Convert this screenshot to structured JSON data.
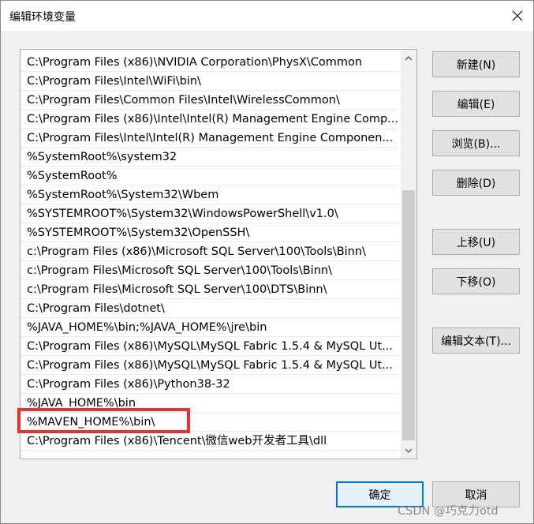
{
  "window": {
    "title": "编辑环境变量"
  },
  "path_list": {
    "items": [
      "C:\\Program Files (x86)\\NVIDIA Corporation\\PhysX\\Common",
      "C:\\Program Files\\Intel\\WiFi\\bin\\",
      "C:\\Program Files\\Common Files\\Intel\\WirelessCommon\\",
      "C:\\Program Files (x86)\\Intel\\Intel(R) Management Engine Comp...",
      "C:\\Program Files\\Intel\\Intel(R) Management Engine Componen...",
      "%SystemRoot%\\system32",
      "%SystemRoot%",
      "%SystemRoot%\\System32\\Wbem",
      "%SYSTEMROOT%\\System32\\WindowsPowerShell\\v1.0\\",
      "%SYSTEMROOT%\\System32\\OpenSSH\\",
      "c:\\Program Files (x86)\\Microsoft SQL Server\\100\\Tools\\Binn\\",
      "c:\\Program Files\\Microsoft SQL Server\\100\\Tools\\Binn\\",
      "c:\\Program Files\\Microsoft SQL Server\\100\\DTS\\Binn\\",
      "C:\\Program Files\\dotnet\\",
      "%JAVA_HOME%\\bin;%JAVA_HOME%\\jre\\bin",
      "C:\\Program Files (x86)\\MySQL\\MySQL Fabric 1.5.4 & MySQL Ut...",
      "C:\\Program Files (x86)\\MySQL\\MySQL Fabric 1.5.4 & MySQL Ut...",
      "C:\\Program Files (x86)\\Python38-32",
      "%JAVA_HOME%\\bin",
      "%MAVEN_HOME%\\bin\\",
      "C:\\Program Files (x86)\\Tencent\\微信web开发者工具\\dll"
    ],
    "highlighted_index": 19,
    "highlight_color": "#e8302e"
  },
  "buttons": {
    "new": "新建(N)",
    "edit": "编辑(E)",
    "browse": "浏览(B)...",
    "delete": "删除(D)",
    "move_up": "上移(U)",
    "move_down": "下移(O)",
    "edit_text": "编辑文本(T)...",
    "ok": "确定",
    "cancel": "取消"
  },
  "icons": {
    "close": "close-icon",
    "scroll_up": "chevron-up-icon",
    "scroll_down": "chevron-down-icon"
  },
  "watermark": "CSDN @巧克力otd"
}
